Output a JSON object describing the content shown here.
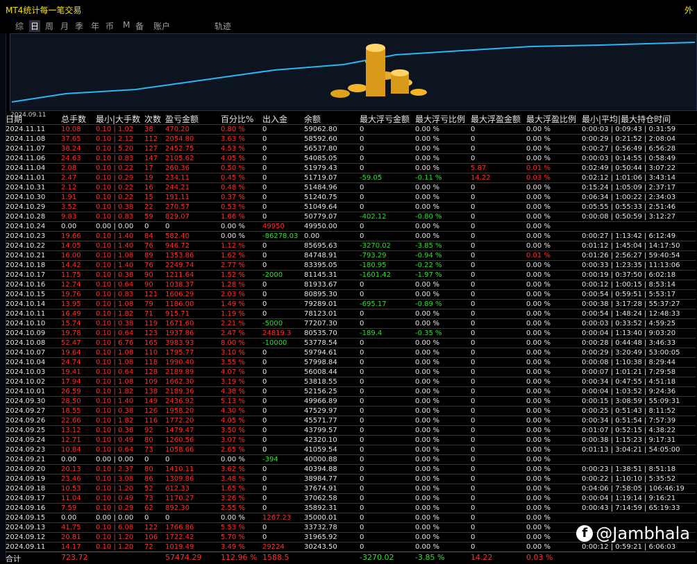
{
  "window": {
    "title": "MT4统计每一笔交易",
    "right_label": "外"
  },
  "tabs": [
    "综",
    "日",
    "周",
    "月",
    "季",
    "年",
    "币",
    "M",
    "备",
    "账户",
    "轨迹"
  ],
  "active_tab": 1,
  "chart": {
    "date_label": "2024.09.11",
    "line_color": "#29b6f6"
  },
  "columns": [
    "日期",
    "总手数",
    "最小|大手数",
    "次数",
    "盈亏金额",
    "百分比%",
    "出入金",
    "余额",
    "最大浮亏金额",
    "最大浮亏比例",
    "最大浮盈金额",
    "最大浮盈比例",
    "最小|平均|最大持仓时间"
  ],
  "rows": [
    [
      "2024.11.11",
      "10.08",
      "0.10 | 1.02",
      "38",
      "470.20",
      "0.80 %",
      "0",
      "59062.80",
      "0",
      "0.00 %",
      "0",
      "0.00 %",
      "0:00:03 | 0:09:43 | 0:31:59"
    ],
    [
      "2024.11.08",
      "37.65",
      "0.10 | 2.12",
      "112",
      "2054.80",
      "3.63 %",
      "0",
      "58592.60",
      "0",
      "0.00 %",
      "0",
      "0.00 %",
      "0:00:29 | 0:21:52 | 2:08:04"
    ],
    [
      "2024.11.07",
      "38.24",
      "0.10 | 5.20",
      "127",
      "2452.75",
      "4.53 %",
      "0",
      "56537.80",
      "0",
      "0.00 %",
      "0",
      "0.00 %",
      "0:00:27 | 0:56:49 | 6:56:28"
    ],
    [
      "2024.11.06",
      "24.63",
      "0.10 | 0.83",
      "147",
      "2105.62",
      "4.05 %",
      "0",
      "54085.05",
      "0",
      "0.00 %",
      "0",
      "0.00 %",
      "0:00:03 | 0:14:55 | 0:58:49"
    ],
    [
      "2024.11.04",
      "2.08",
      "0.10 | 0.22",
      "17",
      "260.36",
      "0.50 %",
      "0",
      "51979.43",
      "0",
      "0.00 %",
      "5.87",
      "0.01 %",
      "0:02:49 | 0:50:44 | 3:07:22"
    ],
    [
      "2024.11.01",
      "2.47",
      "0.10 | 0.29",
      "19",
      "234.11",
      "0.45 %",
      "0",
      "51719.07",
      "-59.05",
      "-0.11 %",
      "14.22",
      "0.03 %",
      "0:02:12 | 1:01:06 | 3:43:14"
    ],
    [
      "2024.10.31",
      "2.12",
      "0.10 | 0.22",
      "16",
      "244.21",
      "0.48 %",
      "0",
      "51484.96",
      "0",
      "0.00 %",
      "0",
      "0.00 %",
      "0:15:24 | 1:05:09 | 2:37:17"
    ],
    [
      "2024.10.30",
      "1.91",
      "0.10 | 0.22",
      "15",
      "191.11",
      "0.37 %",
      "0",
      "51240.75",
      "0",
      "0.00 %",
      "0",
      "0.00 %",
      "0:06:34 | 1:00:22 | 2:34:03"
    ],
    [
      "2024.10.29",
      "3.52",
      "0.10 | 0.38",
      "22",
      "270.57",
      "0.53 %",
      "0",
      "51049.64",
      "0",
      "0.00 %",
      "0",
      "0.00 %",
      "0:05:55 | 0:55:33 | 2:51:46"
    ],
    [
      "2024.10.28",
      "9.83",
      "0.10 | 0.83",
      "59",
      "829.07",
      "1.66 %",
      "0",
      "50779.07",
      "-402.12",
      "-0.80 %",
      "0",
      "0.00 %",
      "0:00:08 | 0:50:59 | 3:12:27"
    ],
    [
      "2024.10.24",
      "0.00",
      "0.00 | 0.00",
      "0",
      "0",
      "0.00 %",
      "49950",
      "49950.00",
      "0",
      "0.00 %",
      "0",
      "0.00 %",
      ""
    ],
    [
      "2024.10.23",
      "19.66",
      "0.10 | 1.40",
      "84",
      "582.40",
      "0.00 %",
      "-86278.03",
      "0.00",
      "0",
      "0.00 %",
      "0",
      "0.00 %",
      "0:00:27 | 1:13:42 | 6:12:49"
    ],
    [
      "2024.10.22",
      "14.05",
      "0.10 | 1.40",
      "76",
      "946.72",
      "1.12 %",
      "0",
      "85695.63",
      "-3270.02",
      "-3.85 %",
      "0",
      "0.00 %",
      "0:01:12 | 1:45:04 | 14:17:50"
    ],
    [
      "2024.10.21",
      "16.00",
      "0.10 | 1.08",
      "89",
      "1353.86",
      "1.62 %",
      "0",
      "84748.91",
      "-793.29",
      "-0.94 %",
      "0",
      "0.01 %",
      "0:01:26 | 2:56:27 | 59:40:54"
    ],
    [
      "2024.10.18",
      "14.42",
      "0.10 | 1.40",
      "76",
      "2249.74",
      "2.77 %",
      "0",
      "83395.05",
      "-180.95",
      "-0.22 %",
      "0",
      "0.00 %",
      "0:00:33 | 1:23:35 | 11:13:06"
    ],
    [
      "2024.10.17",
      "11.75",
      "0.10 | 0.38",
      "90",
      "1211.64",
      "1.52 %",
      "-2000",
      "81145.31",
      "-1601.42",
      "-1.97 %",
      "0",
      "0.00 %",
      "0:00:19 | 0:37:50 | 6:02:18"
    ],
    [
      "2024.10.16",
      "12.74",
      "0.10 | 0.64",
      "90",
      "1038.37",
      "1.28 %",
      "0",
      "81933.67",
      "0",
      "0.00 %",
      "0",
      "0.00 %",
      "0:00:12 | 1:00:15 | 8:53:14"
    ],
    [
      "2024.10.15",
      "19.76",
      "0.10 | 0.83",
      "121",
      "1606.29",
      "2.03 %",
      "0",
      "80895.30",
      "0",
      "0.00 %",
      "0",
      "0.00 %",
      "0:00:54 | 0:59:51 | 5:53:17"
    ],
    [
      "2024.10.14",
      "13.95",
      "0.10 | 1.08",
      "79",
      "1186.00",
      "1.49 %",
      "0",
      "79289.01",
      "-695.17",
      "-0.89 %",
      "0",
      "0.00 %",
      "0:00:38 | 3:17:28 | 55:37:27"
    ],
    [
      "2024.10.11",
      "16.49",
      "0.10 | 1.82",
      "71",
      "915.71",
      "1.19 %",
      "0",
      "78123.01",
      "0",
      "0.00 %",
      "0",
      "0.00 %",
      "0:00:54 | 1:48:24 | 12:48:33"
    ],
    [
      "2024.10.10",
      "15.74",
      "0.10 | 0.38",
      "119",
      "1671.60",
      "2.21 %",
      "-5000",
      "77207.30",
      "0",
      "0.00 %",
      "0",
      "0.00 %",
      "0:00:03 | 0:33:52 | 4:59:25"
    ],
    [
      "2024.10.09",
      "19.78",
      "0.10 | 0.64",
      "123",
      "1937.86",
      "2.47 %",
      "24819.3",
      "80535.70",
      "-189.4",
      "-0.35 %",
      "0",
      "0.00 %",
      "0:00:04 | 1:13:40 | 9:03:20"
    ],
    [
      "2024.10.08",
      "52.47",
      "0.10 | 6.76",
      "165",
      "3983.93",
      "8.00 %",
      "-10000",
      "53778.54",
      "0",
      "0.00 %",
      "0",
      "0.00 %",
      "0:00:28 | 0:44:48 | 3:46:33"
    ],
    [
      "2024.10.07",
      "19.64",
      "0.10 | 1.08",
      "110",
      "1795.77",
      "3.10 %",
      "0",
      "59794.61",
      "0",
      "0.00 %",
      "0",
      "0.00 %",
      "0:00:29 | 3:20:49 | 53:00:05"
    ],
    [
      "2024.10.04",
      "24.74",
      "0.10 | 1.08",
      "118",
      "1990.40",
      "3.55 %",
      "0",
      "57998.84",
      "0",
      "0.00 %",
      "0",
      "0.00 %",
      "0:00:08 | 1:10:38 | 8:29:44"
    ],
    [
      "2024.10.03",
      "19.41",
      "0.10 | 0.64",
      "128",
      "2189.89",
      "4.07 %",
      "0",
      "56008.44",
      "0",
      "0.00 %",
      "0",
      "0.00 %",
      "0:00:07 | 1:01:21 | 7:29:58"
    ],
    [
      "2024.10.02",
      "17.94",
      "0.10 | 1.08",
      "109",
      "1662.30",
      "3.19 %",
      "0",
      "53818.55",
      "0",
      "0.00 %",
      "0",
      "0.00 %",
      "0:00:34 | 0:47:55 | 4:51:18"
    ],
    [
      "2024.10.01",
      "26.59",
      "0.10 | 1.82",
      "138",
      "2189.36",
      "4.38 %",
      "0",
      "52156.25",
      "0",
      "0.00 %",
      "0",
      "0.00 %",
      "0:00:04 | 1:03:52 | 9:24:36"
    ],
    [
      "2024.09.30",
      "28.50",
      "0.10 | 1.40",
      "149",
      "2436.92",
      "5.13 %",
      "0",
      "49966.89",
      "0",
      "0.00 %",
      "0",
      "0.00 %",
      "0:00:15 | 3:08:59 | 55:09:31"
    ],
    [
      "2024.09.27",
      "18.55",
      "0.10 | 0.38",
      "126",
      "1958.20",
      "4.30 %",
      "0",
      "47529.97",
      "0",
      "0.00 %",
      "0",
      "0.00 %",
      "0:00:25 | 0:51:43 | 8:11:52"
    ],
    [
      "2024.09.26",
      "22.66",
      "0.10 | 1.82",
      "116",
      "1772.20",
      "4.05 %",
      "0",
      "45571.77",
      "0",
      "0.00 %",
      "0",
      "0.00 %",
      "0:00:34 | 0:51:54 | 7:57:39"
    ],
    [
      "2024.09.25",
      "13.12",
      "0.10 | 0.38",
      "92",
      "1479.47",
      "3.50 %",
      "0",
      "43799.57",
      "0",
      "0.00 %",
      "0",
      "0.00 %",
      "0:01:07 | 0:52:15 | 4:38:22"
    ],
    [
      "2024.09.24",
      "12.71",
      "0.10 | 0.49",
      "80",
      "1260.56",
      "3.07 %",
      "0",
      "42320.10",
      "0",
      "0.00 %",
      "0",
      "0.00 %",
      "0:00:38 | 1:15:23 | 9:17:31"
    ],
    [
      "2024.09.23",
      "10.84",
      "0.10 | 0.64",
      "73",
      "1058.66",
      "2.65 %",
      "0",
      "41059.54",
      "0",
      "0.00 %",
      "0",
      "0.00 %",
      "0:01:13 | 3:04:21 | 54:05:00"
    ],
    [
      "2024.09.21",
      "0.00",
      "0.00 | 0.00",
      "0",
      "0",
      "0.00 %",
      "-394",
      "40000.88",
      "0",
      "0.00 %",
      "0",
      "0.00 %",
      ""
    ],
    [
      "2024.09.20",
      "20.13",
      "0.10 | 2.37",
      "80",
      "1410.11",
      "3.62 %",
      "0",
      "40394.88",
      "0",
      "0.00 %",
      "0",
      "0.00 %",
      "0:00:23 | 1:38:51 | 8:51:18"
    ],
    [
      "2024.09.19",
      "23.46",
      "0.10 | 3.08",
      "86",
      "1309.86",
      "3.48 %",
      "0",
      "38984.77",
      "0",
      "0.00 %",
      "0",
      "0.00 %",
      "0:00:22 | 1:10:10 | 5:35:52"
    ],
    [
      "2024.09.18",
      "10.53",
      "0.10 | 1.20",
      "52",
      "612.33",
      "1.65 %",
      "0",
      "37674.91",
      "0",
      "0.00 %",
      "0",
      "0.00 %",
      "0:04:06 | 7:58:05 | 106:46:19"
    ],
    [
      "2024.09.17",
      "11.04",
      "0.10 | 0.49",
      "73",
      "1170.27",
      "3.26 %",
      "0",
      "37062.58",
      "0",
      "0.00 %",
      "0",
      "0.00 %",
      "0:00:04 | 1:19:14 | 9:16:21"
    ],
    [
      "2024.09.16",
      "7.59",
      "0.10 | 0.29",
      "62",
      "892.30",
      "2.55 %",
      "0",
      "35892.31",
      "0",
      "0.00 %",
      "0",
      "0.00 %",
      "0:00:43 | 7:14:59 | 65:19:33"
    ],
    [
      "2024.09.15",
      "0.00",
      "0.00 | 0.00",
      "0",
      "0",
      "0.00 %",
      "1267.23",
      "35000.01",
      "0",
      "0.00 %",
      "0",
      "0.00 %",
      ""
    ],
    [
      "2024.09.13",
      "41.75",
      "0.10 | 6.08",
      "122",
      "1766.86",
      "5.53 %",
      "0",
      "33732.78",
      "0",
      "0.00 %",
      "0",
      "0.00 %",
      ""
    ],
    [
      "2024.09.12",
      "20.81",
      "0.10 | 1.20",
      "106",
      "1722.42",
      "5.70 %",
      "0",
      "31965.92",
      "0",
      "0.00 %",
      "0",
      "0.00 %",
      ""
    ],
    [
      "2024.09.11",
      "14.17",
      "0.10 | 1.20",
      "72",
      "1019.49",
      "3.49 %",
      "29224",
      "30243.50",
      "0",
      "0.00 %",
      "0",
      "0.00 %",
      "0:00:12 | 0:59:21 | 6:06:03"
    ]
  ],
  "total": [
    "合计",
    "723.72",
    "",
    "",
    "57474.29",
    "112.96 %",
    "1588.5",
    "",
    "-3270.02",
    "-3.85 %",
    "14.22",
    "0.03 %",
    ""
  ],
  "watermark": "@Jambhala"
}
